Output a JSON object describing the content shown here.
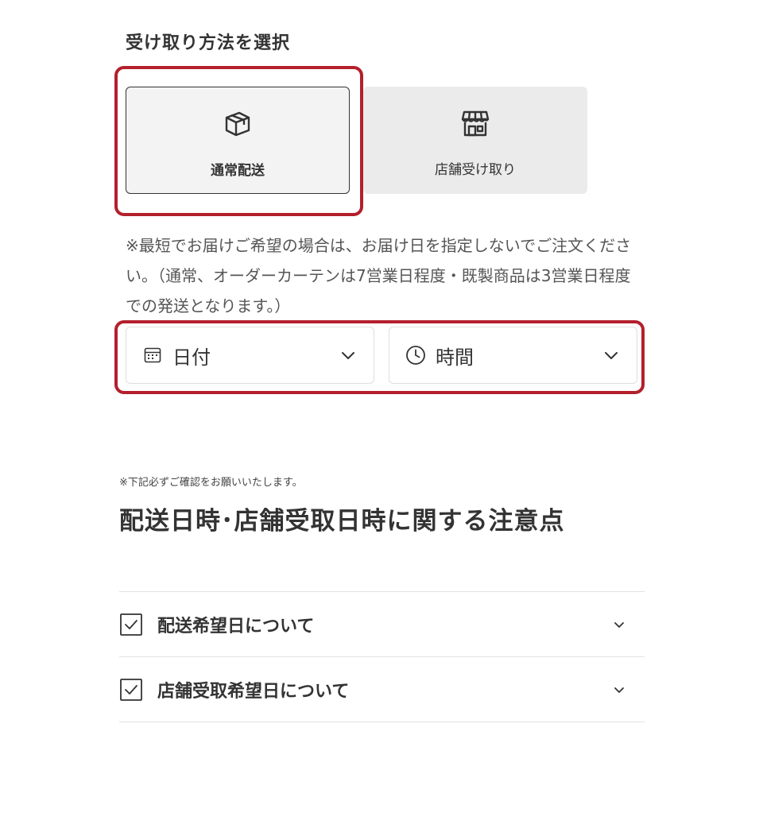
{
  "receive_method": {
    "title": "受け取り方法を選択",
    "options": [
      {
        "label": "通常配送",
        "icon": "package-box-icon",
        "selected": true
      },
      {
        "label": "店舗受け取り",
        "icon": "storefront-icon",
        "selected": false
      }
    ]
  },
  "delivery_note": "※最短でお届けご希望の場合は、お届け日を指定しないでご注文ください。（通常、オーダーカーテンは7営業日程度・既製商品は3営業日程度での発送となります。）",
  "date_select": {
    "label": "日付",
    "icon": "calendar-icon"
  },
  "time_select": {
    "label": "時間",
    "icon": "clock-icon"
  },
  "confirm_note": "※下記必ずご確認をお願いいたします。",
  "notice_heading": "配送日時･店舗受取日時に関する注意点",
  "accordion": [
    {
      "label": "配送希望日について",
      "icon": "checkbox-icon"
    },
    {
      "label": "店舗受取希望日について",
      "icon": "checkbox-icon"
    }
  ],
  "colors": {
    "highlight": "#b3202c",
    "selected_card_bg": "#f3f3f3",
    "unselected_card_bg": "#ebebeb",
    "text": "#333333"
  }
}
